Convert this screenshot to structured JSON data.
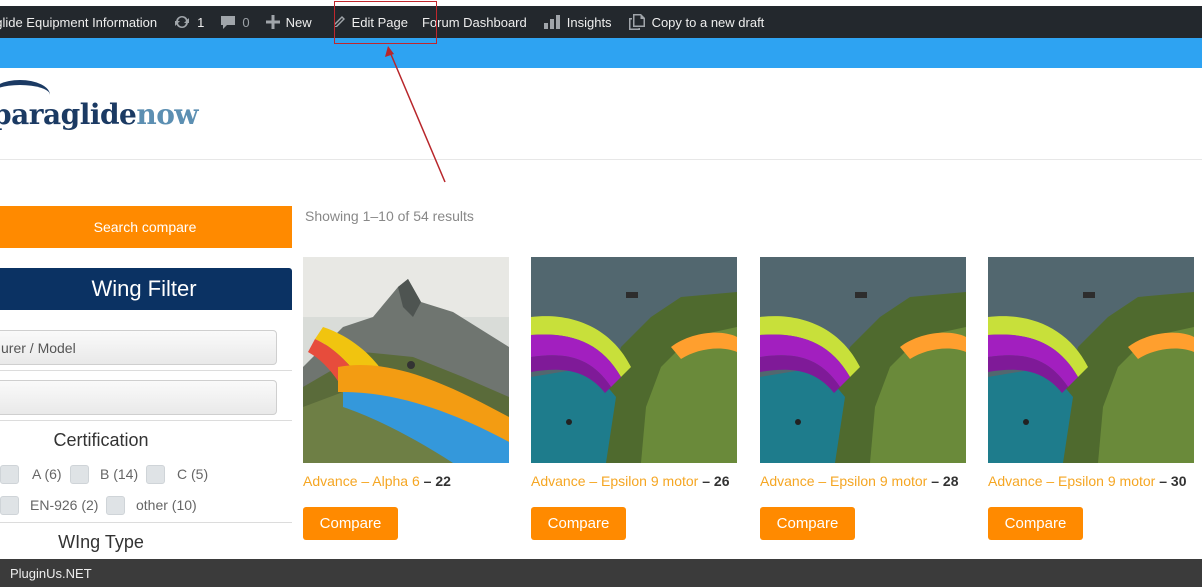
{
  "admin_bar": {
    "site_name": "aglide Equipment Information",
    "updates_count": "1",
    "comments_count": "0",
    "new_label": "New",
    "edit_page_label": "Edit Page",
    "forum_label": "Forum Dashboard",
    "insights_label": "Insights",
    "copy_label": "Copy to a new draft"
  },
  "logo": {
    "part1": "paraglide",
    "part2": "now"
  },
  "sidebar": {
    "search_compare": "Search compare",
    "wing_filter": "Wing Filter",
    "manufacturer_placeholder": "urer / Model",
    "certification_title": "Certification",
    "cert_options": [
      {
        "label": "A (6)"
      },
      {
        "label": "B (14)"
      },
      {
        "label": "C (5)"
      },
      {
        "label": "EN-926 (2)"
      },
      {
        "label": "other (10)"
      }
    ],
    "wing_type_title": "WIng Type"
  },
  "main": {
    "results_text": "Showing 1–10 of 54 results",
    "compare_label": "Compare",
    "products": [
      {
        "name": "Advance – Alpha 6",
        "sep": " – ",
        "count": "22"
      },
      {
        "name": "Advance – Epsilon 9 motor",
        "sep": " – ",
        "count": "26"
      },
      {
        "name": "Advance – Epsilon 9 motor",
        "sep": " – ",
        "count": "28"
      },
      {
        "name": "Advance – Epsilon 9 motor",
        "sep": " – ",
        "count": "30"
      }
    ]
  },
  "footer": {
    "text": "PluginUs.NET"
  },
  "colors": {
    "accent": "#ff8a00",
    "navy": "#0b3263",
    "blue_strip": "#2ea3f2",
    "admin_bg": "#23282d"
  }
}
